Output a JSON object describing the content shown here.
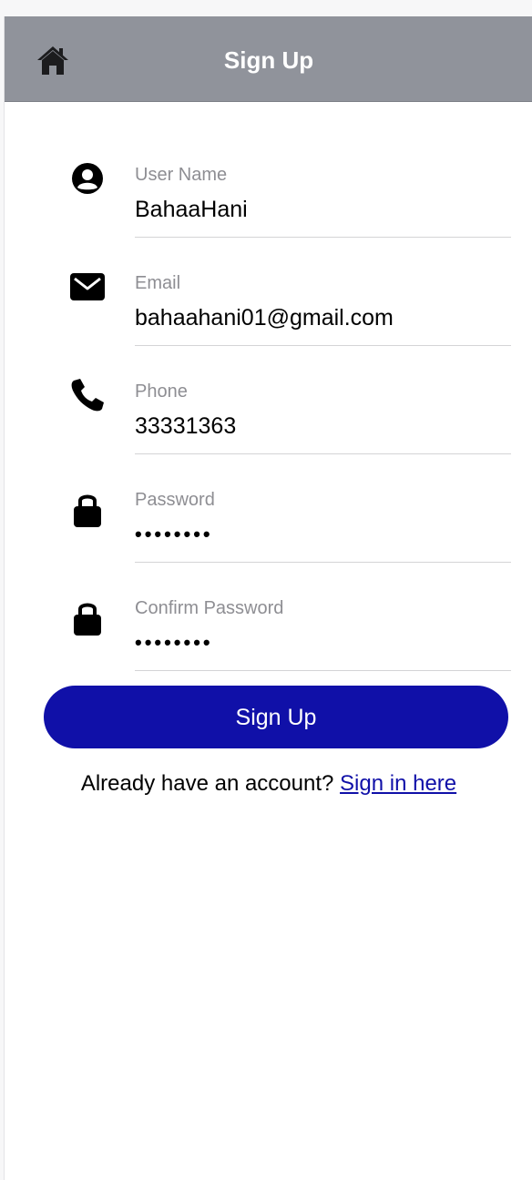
{
  "header": {
    "title": "Sign Up",
    "home_icon": "home-icon"
  },
  "form": {
    "fields": [
      {
        "icon": "user-circle-icon",
        "label": "User Name",
        "value": "BahaaHani"
      },
      {
        "icon": "envelope-icon",
        "label": "Email",
        "value": "bahaahani01@gmail.com"
      },
      {
        "icon": "phone-icon",
        "label": "Phone",
        "value": "33331363"
      },
      {
        "icon": "lock-icon",
        "label": "Password",
        "value": "••••••••"
      },
      {
        "icon": "lock-icon",
        "label": "Confirm Password",
        "value": "••••••••"
      }
    ],
    "submit_label": "Sign Up"
  },
  "footer": {
    "prompt": "Already have an account?",
    "link_label": "Sign in here"
  },
  "colors": {
    "header_bg": "#90939b",
    "button_bg": "#1010a8",
    "label_gray": "#8e8e93"
  }
}
